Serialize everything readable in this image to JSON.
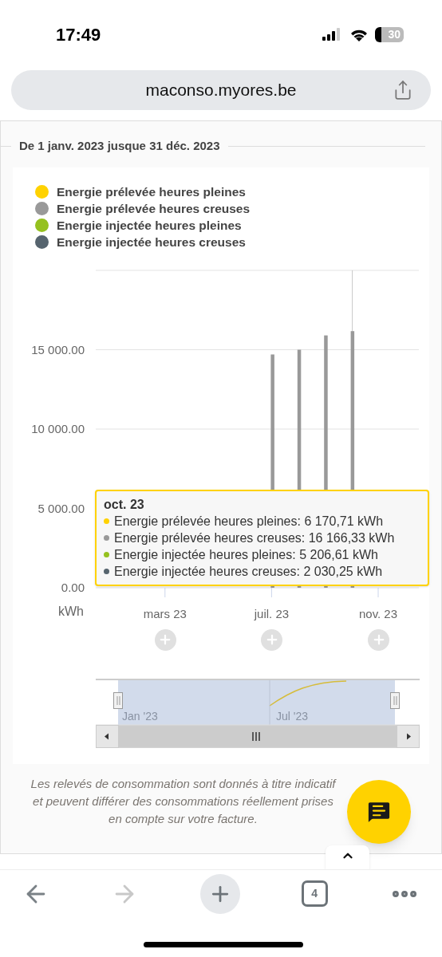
{
  "status_bar": {
    "time": "17:49",
    "battery": "30"
  },
  "address_bar": {
    "url": "maconso.myores.be"
  },
  "period": {
    "title": "De 1 janv. 2023 jusque 31 déc. 2023"
  },
  "chart": {
    "chart_data": {
      "type": "bar",
      "ylabel": "kWh",
      "ylim": [
        0,
        20000
      ],
      "categories": [
        null,
        null,
        "mars 23",
        null,
        null,
        null,
        "juil. 23",
        null,
        null,
        null,
        "nov. 23",
        null
      ],
      "yticks": [
        {
          "value": 0,
          "label": "0.00"
        },
        {
          "value": 5000,
          "label": "5 000.00"
        },
        {
          "value": 10000,
          "label": "10 000.00"
        },
        {
          "value": 15000,
          "label": "15 000.00"
        }
      ],
      "series": [
        {
          "name": "Energie prélevée heures pleines",
          "color": "#ffd200",
          "values": [
            null,
            null,
            null,
            null,
            null,
            null,
            null,
            null,
            null,
            null,
            null,
            null
          ]
        },
        {
          "name": "Energie prélevée heures creuses",
          "color": "#999999",
          "values": [
            null,
            null,
            null,
            null,
            null,
            null,
            14700,
            15000,
            15900,
            16170,
            null,
            null
          ]
        },
        {
          "name": "Energie injectée heures pleines",
          "color": "#95c11f",
          "values": [
            null,
            null,
            null,
            null,
            null,
            null,
            null,
            null,
            null,
            null,
            null,
            null
          ]
        },
        {
          "name": "Energie injectée heures creuses",
          "color": "#56646e",
          "values": [
            null,
            null,
            null,
            null,
            null,
            null,
            null,
            null,
            null,
            null,
            null,
            null
          ]
        }
      ]
    },
    "tooltip": {
      "title": "oct. 23",
      "rows": [
        {
          "label": "Energie prélevée heures pleines: 6 170,71 kWh",
          "color": "#ffd200"
        },
        {
          "label": "Energie prélevée heures creuses: 16 166,33 kWh",
          "color": "#999999"
        },
        {
          "label": "Energie injectée heures pleines: 5 206,61 kWh",
          "color": "#95c11f"
        },
        {
          "label": "Energie injectée heures creuses: 2 030,25 kWh",
          "color": "#56646e"
        }
      ]
    },
    "navigator": {
      "labels": [
        "Jan '23",
        "Jul '23"
      ]
    }
  },
  "footnote": "Les relevés de consommation sont donnés à titre indicatif et peuvent différer des consommations réellement prises en compte sur votre facture.",
  "toolbar": {
    "tab_count": "4"
  }
}
